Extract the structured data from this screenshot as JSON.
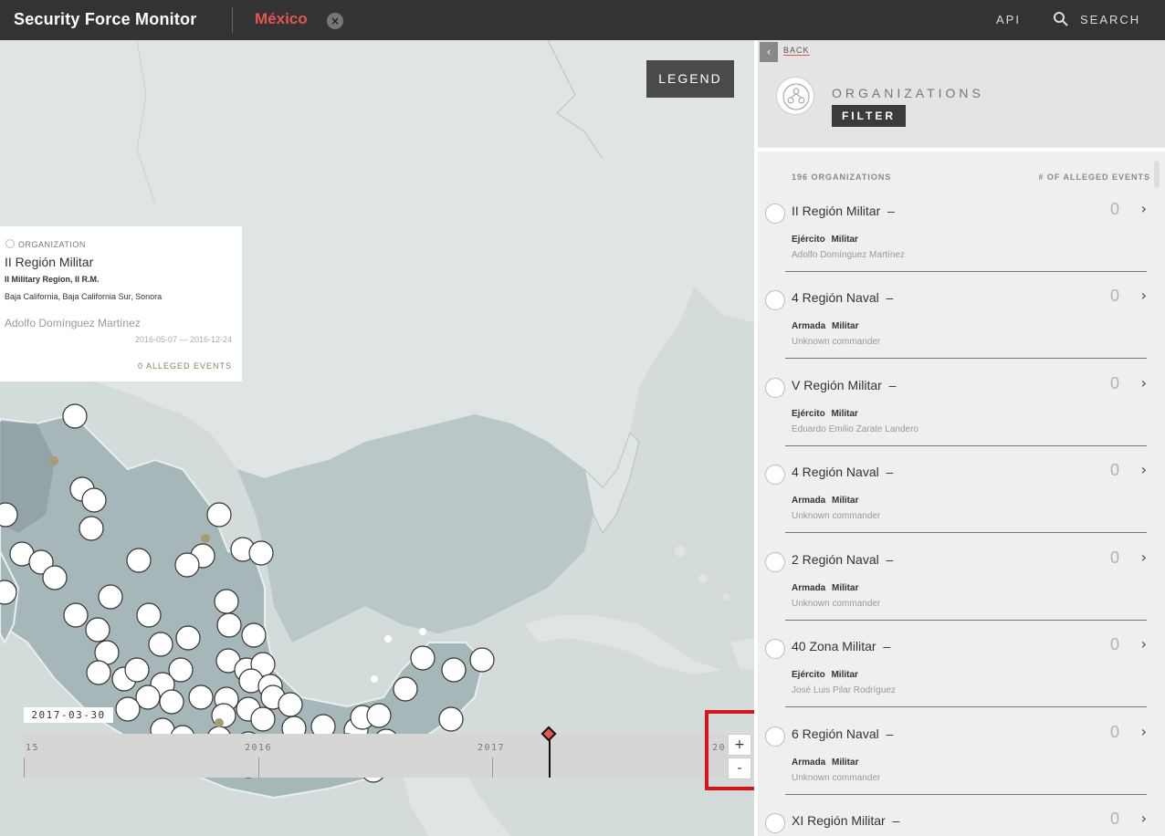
{
  "app": {
    "brand": "Security Force Monitor",
    "country": "México",
    "country_close": "×",
    "api": "API",
    "search": "SEARCH"
  },
  "map": {
    "legend": "LEGEND",
    "popup": {
      "type": "ORGANIZATION",
      "name": "II Región Militar",
      "alias": "II Military Region, II R.M.",
      "area": "Baja California, Baja California Sur, Sonora",
      "commander": "Adolfo Domínguez Martínez",
      "dates": "2016-05-07  —  2016-12-24",
      "events": "0 ALLEGED EVENTS"
    },
    "current_date": "2017-03-30",
    "timeline": {
      "labels": [
        "15",
        "2016",
        "2017",
        "20"
      ],
      "zoom_in": "+",
      "zoom_out": "-"
    }
  },
  "panel": {
    "back": "BACK",
    "title": "ORGANIZATIONS",
    "filter": "FILTER",
    "count": "196 ORGANIZATIONS",
    "events_header": "# OF ALLEGED EVENTS",
    "items": [
      {
        "name": "II Región Militar",
        "dash": "–",
        "count": "0",
        "tags": "Ejército  Militar",
        "commander": "Adolfo Domínguez Martínez"
      },
      {
        "name": "4 Región Naval",
        "dash": "–",
        "count": "0",
        "tags": "Armada  Militar",
        "commander": "Unknown commander"
      },
      {
        "name": "V Región Militar",
        "dash": "–",
        "count": "0",
        "tags": "Ejército  Militar",
        "commander": "Eduardo Emilio Zarate Landero"
      },
      {
        "name": "4 Región Naval",
        "dash": "–",
        "count": "0",
        "tags": "Armada  Militar",
        "commander": "Unknown commander"
      },
      {
        "name": "2 Región Naval",
        "dash": "–",
        "count": "0",
        "tags": "Armada  Militar",
        "commander": "Unknown commander"
      },
      {
        "name": "40 Zona Militar",
        "dash": "–",
        "count": "0",
        "tags": "Ejército  Militar",
        "commander": "José Luis Pilar Rodríguez"
      },
      {
        "name": "6 Región Naval",
        "dash": "–",
        "count": "0",
        "tags": "Armada  Militar",
        "commander": "Unknown commander"
      },
      {
        "name": "XI Región Militar",
        "dash": "–",
        "count": "0",
        "tags": "",
        "commander": ""
      }
    ]
  },
  "colors": {
    "topbar": "#333333",
    "accent": "#e5574e",
    "highlight": "#d8141b",
    "land": "#a8bcbd",
    "water": "#d3dbdb"
  }
}
